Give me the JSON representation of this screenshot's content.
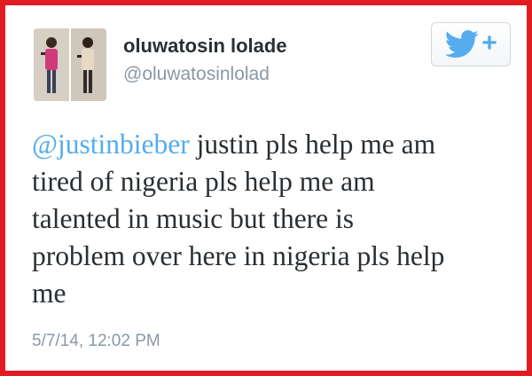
{
  "tweet": {
    "author": {
      "display_name": "oluwatosin lolade",
      "handle": "@oluwatosinlolad",
      "avatar": "profile-photo"
    },
    "follow_button": {
      "icon": "twitter-bird-icon",
      "plus": "+"
    },
    "text": {
      "mention": "@justinbieber",
      "body_line1": " justin pls help me am",
      "body_line2": "tired of nigeria pls help me am",
      "body_line3": "talented in music but there is",
      "body_line4": "problem over here in nigeria pls help",
      "body_line5": "me"
    },
    "timestamp": "5/7/14, 12:02 PM"
  },
  "colors": {
    "frame": "#e01b24",
    "link": "#55acee",
    "muted": "#8899a6",
    "text": "#292f33"
  }
}
